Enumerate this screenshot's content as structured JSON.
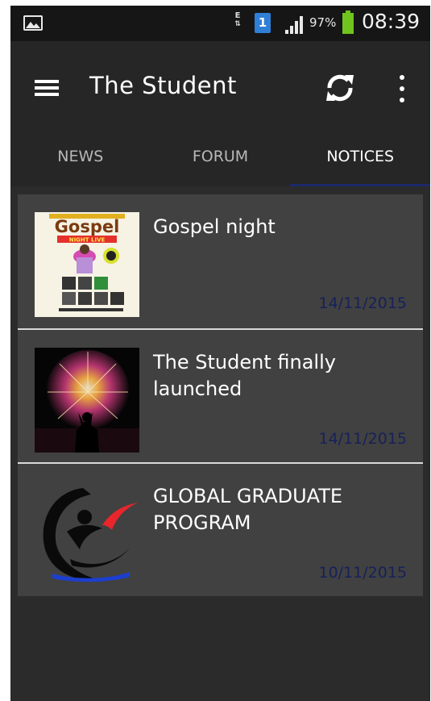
{
  "status_bar": {
    "data_indicator": "E",
    "sim_slot": "1",
    "battery_percent": "97%",
    "time": "08:39",
    "icons": [
      "gallery-notification-icon",
      "data-transfer-icon",
      "sim-icon",
      "signal-icon",
      "battery-icon"
    ]
  },
  "app_bar": {
    "title": "The Student",
    "icons": [
      "menu-icon",
      "refresh-icon",
      "more-options-icon"
    ]
  },
  "tabs": [
    {
      "label": "NEWS",
      "active": false
    },
    {
      "label": "FORUM",
      "active": false
    },
    {
      "label": "NOTICES",
      "active": true
    }
  ],
  "notices": [
    {
      "title": "Gospel night",
      "date": "14/11/2015",
      "thumbnail": {
        "kind": "poster",
        "poster_title": "Gospel",
        "poster_subtitle": "NIGHT LIVE"
      }
    },
    {
      "title": "The Student finally launched",
      "date": "14/11/2015",
      "thumbnail": {
        "kind": "fireworks-photo"
      }
    },
    {
      "title": "GLOBAL GRADUATE PROGRAM",
      "date": "10/11/2015",
      "thumbnail": {
        "kind": "logo"
      }
    }
  ],
  "colors": {
    "status_bar": "#161616",
    "app_bar": "#262626",
    "card": "#414141",
    "active_tab_indicator": "#1c2a6b",
    "date_text": "#16215a",
    "battery": "#6fc51e",
    "sim": "#2f7fd6"
  }
}
